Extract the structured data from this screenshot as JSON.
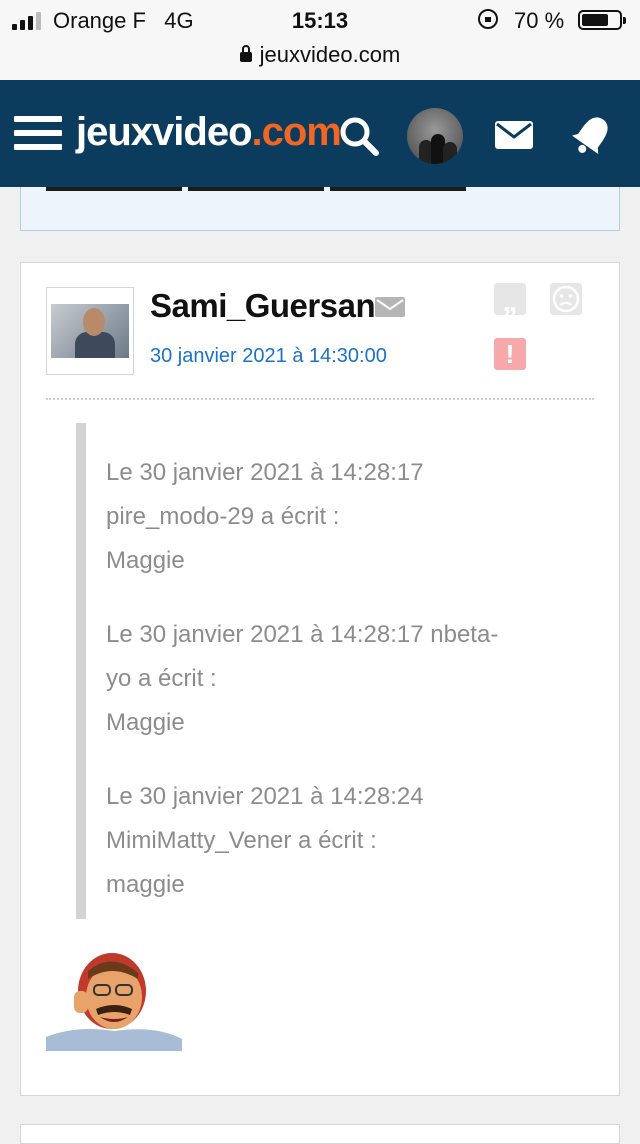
{
  "status_bar": {
    "carrier": "Orange F",
    "network": "4G",
    "time": "15:13",
    "battery_percent": "70 %",
    "battery_level": 0.7,
    "url": "jeuxvideo.com"
  },
  "header": {
    "logo_main": "jeuxvideo",
    "logo_suffix": ".com",
    "brand_color": "#0b3c5d",
    "accent_color": "#f26522",
    "icons": [
      "menu-icon",
      "search-icon",
      "user-avatar",
      "mail-icon",
      "notification-bell-icon"
    ]
  },
  "message": {
    "author": "Sami_Guersan",
    "date": "30 janvier 2021 à 14:30:00",
    "actions": [
      "quote-icon",
      "blacklist-icon",
      "report-icon"
    ],
    "quotes": [
      {
        "lines": [
          "Le 30 janvier 2021 à 14:28:17",
          "pire_modo-29 a écrit :",
          "Maggie"
        ]
      },
      {
        "lines": [
          "Le 30 janvier 2021 à 14:28:17 nbeta-",
          "yo a écrit :",
          "Maggie"
        ]
      },
      {
        "lines": [
          "Le 30 janvier 2021 à 14:28:24",
          "MimiMatty_Vener a écrit :",
          "maggie"
        ]
      }
    ],
    "sticker": "laughing-man-sticker"
  }
}
